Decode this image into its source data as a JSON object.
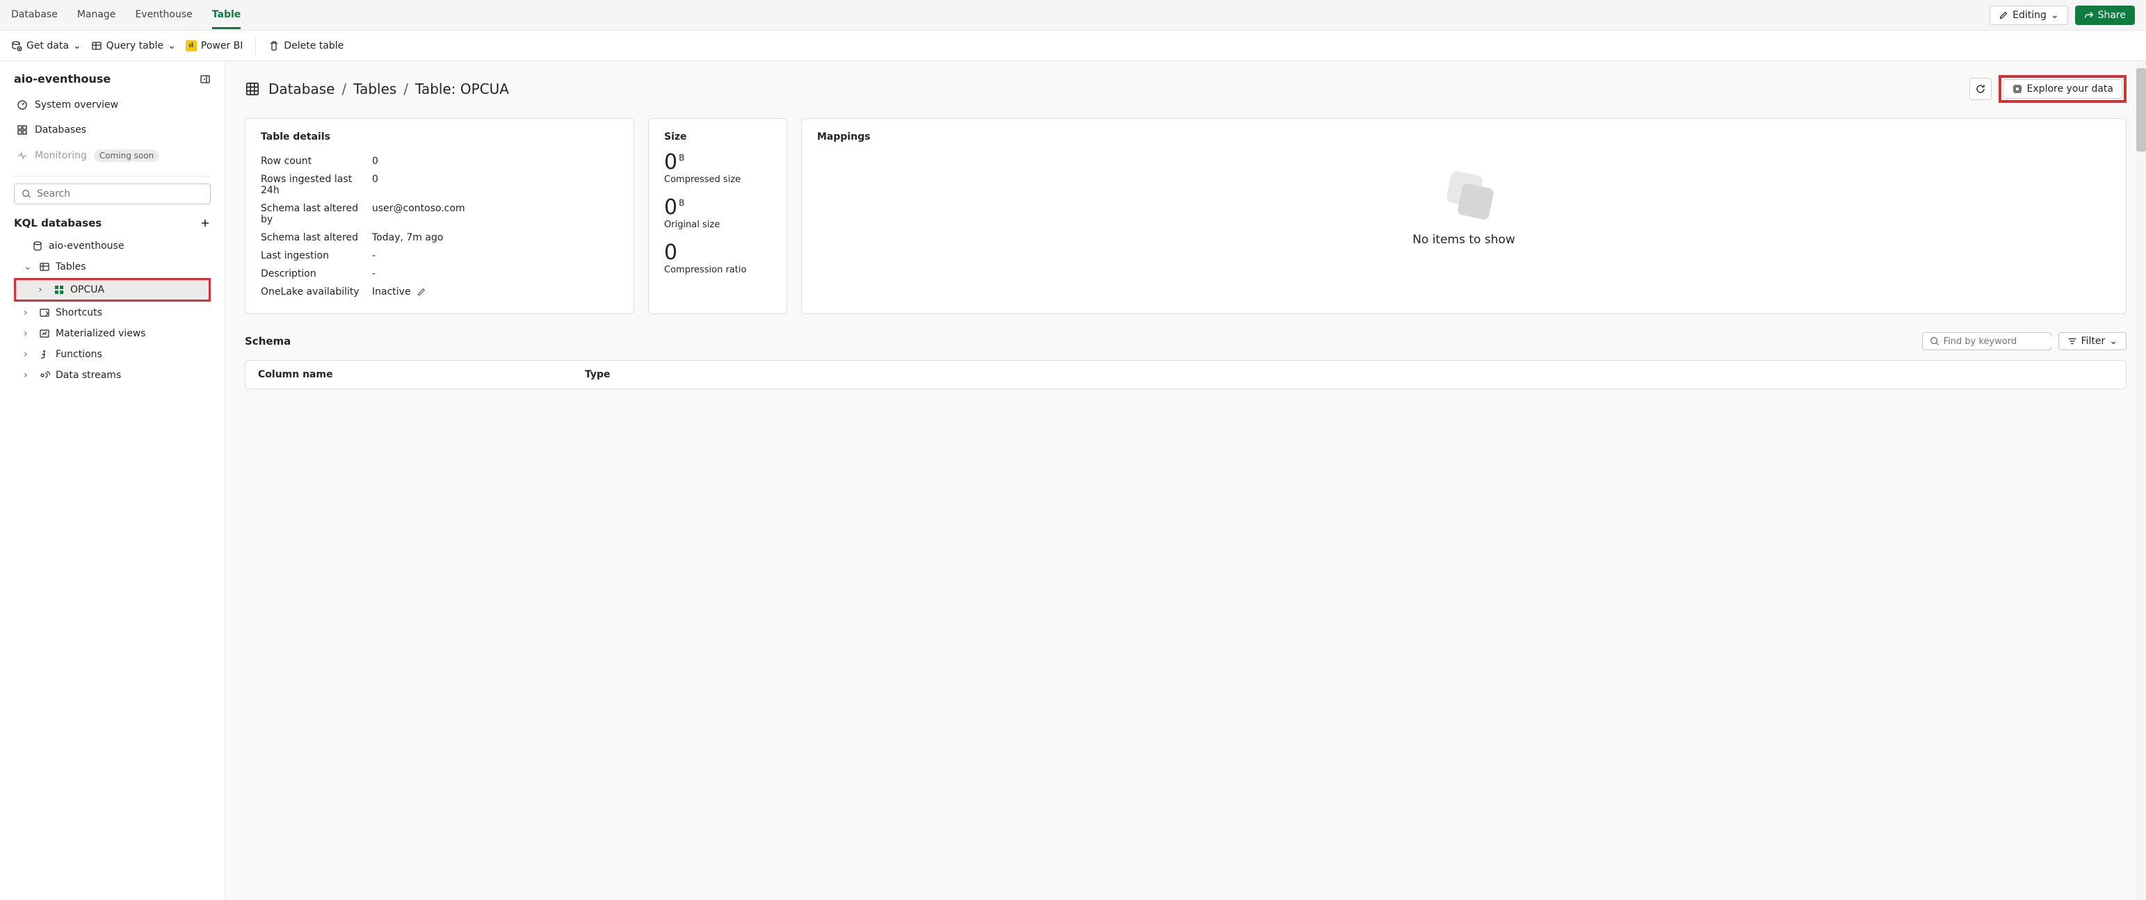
{
  "tabs": {
    "items": [
      "Database",
      "Manage",
      "Eventhouse",
      "Table"
    ],
    "active": "Table"
  },
  "top_actions": {
    "editing": "Editing",
    "share": "Share"
  },
  "toolbar": {
    "get_data": "Get data",
    "query_table": "Query table",
    "power_bi": "Power BI",
    "delete_table": "Delete table"
  },
  "sidebar": {
    "title": "aio-eventhouse",
    "nav": {
      "system_overview": "System overview",
      "databases": "Databases",
      "monitoring": "Monitoring",
      "monitoring_badge": "Coming soon"
    },
    "search_placeholder": "Search",
    "section_title": "KQL databases",
    "tree": {
      "db": "aio-eventhouse",
      "tables": "Tables",
      "opcua": "OPCUA",
      "shortcuts": "Shortcuts",
      "materialized_views": "Materialized views",
      "functions": "Functions",
      "data_streams": "Data streams"
    }
  },
  "breadcrumb": {
    "database": "Database",
    "tables": "Tables",
    "current": "Table: OPCUA"
  },
  "main_actions": {
    "explore": "Explore your data"
  },
  "details_card": {
    "title": "Table details",
    "rows": [
      {
        "key": "Row count",
        "val": "0"
      },
      {
        "key": "Rows ingested last 24h",
        "val": "0"
      },
      {
        "key": "Schema last altered by",
        "val": "user@contoso.com"
      },
      {
        "key": "Schema last altered",
        "val": "Today, 7m ago"
      },
      {
        "key": "Last ingestion",
        "val": "-"
      },
      {
        "key": "Description",
        "val": "-"
      },
      {
        "key": "OneLake availability",
        "val": "Inactive"
      }
    ]
  },
  "size_card": {
    "title": "Size",
    "blocks": [
      {
        "value": "0",
        "sup": "B",
        "label": "Compressed size"
      },
      {
        "value": "0",
        "sup": "B",
        "label": "Original size"
      },
      {
        "value": "0",
        "sup": "",
        "label": "Compression ratio"
      }
    ]
  },
  "mappings_card": {
    "title": "Mappings",
    "no_items": "No items to show"
  },
  "schema": {
    "title": "Schema",
    "find_placeholder": "Find by keyword",
    "filter_label": "Filter",
    "columns": {
      "name": "Column name",
      "type": "Type"
    }
  }
}
